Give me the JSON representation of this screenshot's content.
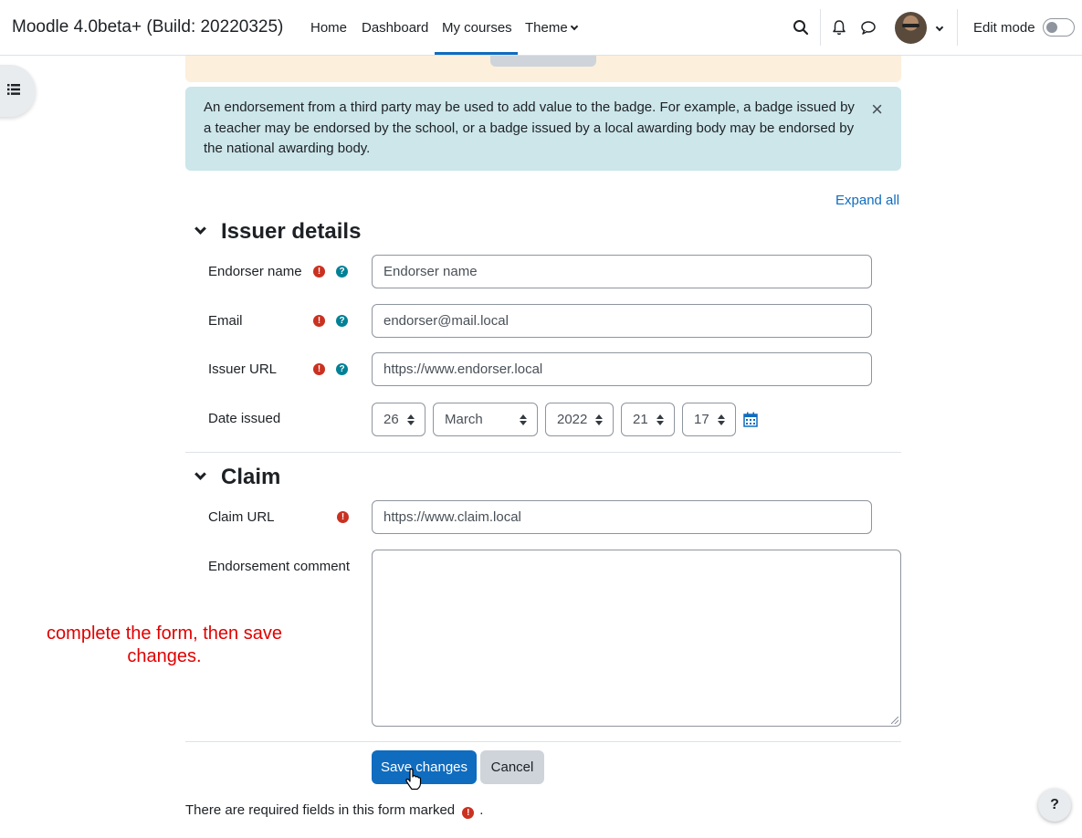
{
  "navbar": {
    "site_name": "Moodle 4.0beta+ (Build: 20220325)",
    "links": [
      "Home",
      "Dashboard",
      "My courses",
      "Theme"
    ],
    "edit_mode_label": "Edit mode"
  },
  "alerts": {
    "info_text": "An endorsement from a third party may be used to add value to the badge. For example, a badge issued by a teacher may be endorsed by the school, or a badge issued by a local awarding body may be endorsed by the national awarding body.",
    "close_symbol": "×"
  },
  "expand_all": "Expand all",
  "issuer": {
    "heading": "Issuer details",
    "endorser_name_label": "Endorser name",
    "endorser_name_placeholder": "Endorser name",
    "email_label": "Email",
    "email_value": "endorser@mail.local",
    "issuer_url_label": "Issuer URL",
    "issuer_url_value": "https://www.endorser.local",
    "date_label": "Date issued",
    "date": {
      "day": "26",
      "month": "March",
      "year": "2022",
      "hour": "21",
      "minute": "17"
    }
  },
  "claim": {
    "heading": "Claim",
    "claim_url_label": "Claim URL",
    "claim_url_value": "https://www.claim.local",
    "comment_label": "Endorsement comment"
  },
  "buttons": {
    "save": "Save changes",
    "cancel": "Cancel"
  },
  "required_note": "There are required fields in this form marked",
  "annotation": "complete the form, then save changes.",
  "colors": {
    "primary": "#0f6cbf",
    "required": "#ca3120",
    "help": "#008196",
    "info_bg": "#cce6ea",
    "annotation": "#e00000"
  }
}
